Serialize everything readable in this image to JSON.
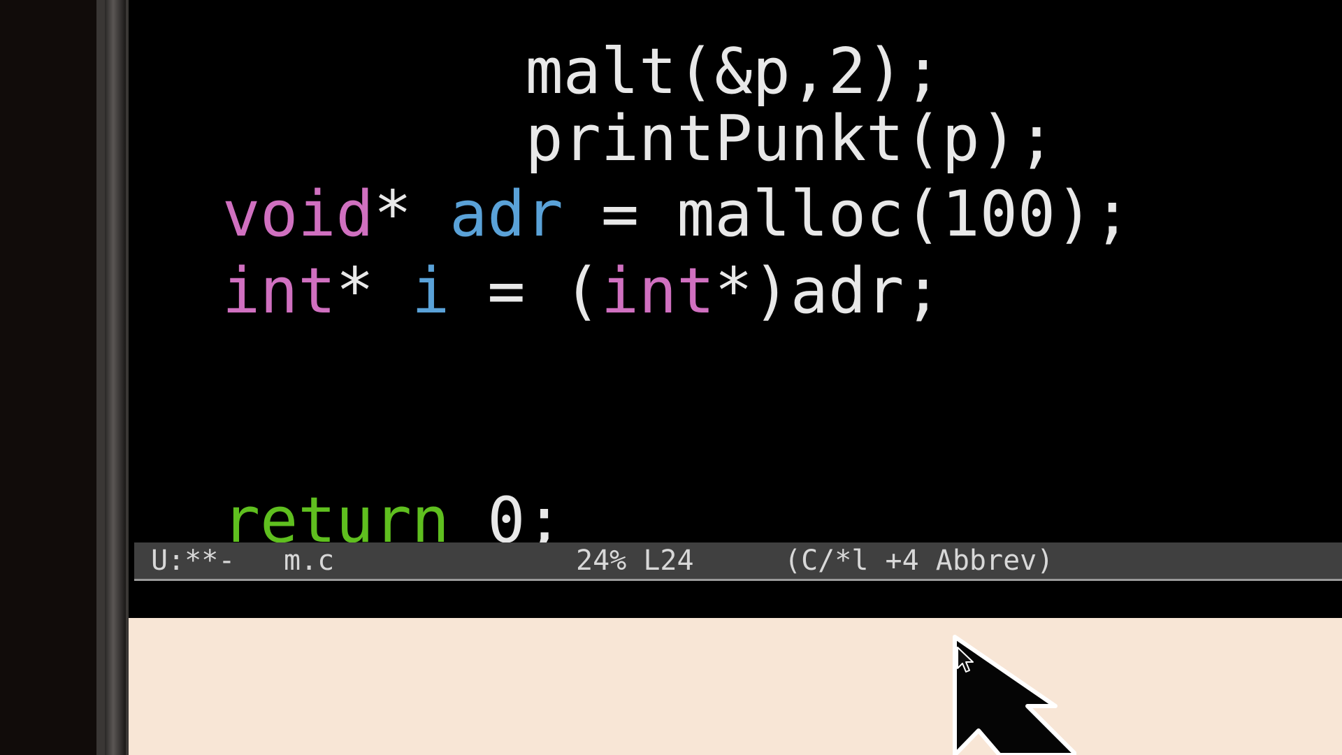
{
  "editor": {
    "lines": {
      "partial_top": "malt(&p,2);",
      "print_call": "printPunkt(p);",
      "malloc": {
        "type": "void",
        "star": "*",
        "var": "adr",
        "rest": " = malloc(100);"
      },
      "cast": {
        "type": "int",
        "star": "* ",
        "var": "i",
        "eq": " = (",
        "cast_type": "int",
        "rest": "*)adr;"
      },
      "return_line": {
        "keyword": "return",
        "rest": " 0;"
      }
    }
  },
  "mode_line": {
    "status": "U:**-",
    "buffer_name": "m.c",
    "position": "24% L24",
    "modes": "(C/*l +4 Abbrev)"
  },
  "colors": {
    "type_keyword": "#d070c0",
    "variable": "#5aa2d8",
    "return_keyword": "#5fbf1f",
    "mode_line_bg": "#404040",
    "desktop_bg": "#f8e6d6"
  },
  "icons": {
    "cursor": "mouse-pointer-icon"
  }
}
